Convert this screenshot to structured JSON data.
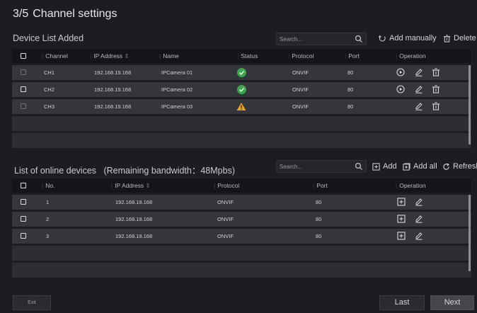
{
  "window": {
    "step": "3/5",
    "title": "Channel settings"
  },
  "added": {
    "title": "Device List Added",
    "search_placeholder": "Search...",
    "add_manually": "Add manually",
    "delete": "Delete",
    "headers": [
      "Channel",
      "IP Address",
      "Name",
      "Status",
      "Protocol",
      "Port",
      "Operation"
    ],
    "rows": [
      {
        "channel": "CH1",
        "ip": "192.168.19.168",
        "name": "IPCamera 01",
        "status": "ok",
        "protocol": "ONVIF",
        "port": "80"
      },
      {
        "channel": "CH2",
        "ip": "192.168.19.168",
        "name": "IPCamera 02",
        "status": "ok",
        "protocol": "ONVIF",
        "port": "80"
      },
      {
        "channel": "CH3",
        "ip": "192.168.19.168",
        "name": "IPCamera 03",
        "status": "warning",
        "protocol": "ONVIF",
        "port": "80"
      }
    ]
  },
  "online": {
    "title": "List of online devices",
    "bandwidth": "(Remaining bandwidth：48Mpbs)",
    "search_placeholder": "Search...",
    "add": "Add",
    "add_all": "Add all",
    "refresh": "Refresh",
    "headers": [
      "No.",
      "IP Address",
      "Protocol",
      "Port",
      "Operation"
    ],
    "rows": [
      {
        "no": "1",
        "ip": "192.168.19.168",
        "protocol": "ONVIF",
        "port": "80"
      },
      {
        "no": "2",
        "ip": "192.168.19.168",
        "protocol": "ONVIF",
        "port": "80"
      },
      {
        "no": "3",
        "ip": "192.168.19.168",
        "protocol": "ONVIF",
        "port": "80"
      }
    ]
  },
  "footer": {
    "exit": "Exit",
    "last": "Last",
    "next": "Next"
  },
  "colors": {
    "ok": "#3aa84a",
    "warning": "#e7a321",
    "bg": "#1c1d21",
    "row": "#34363c"
  }
}
